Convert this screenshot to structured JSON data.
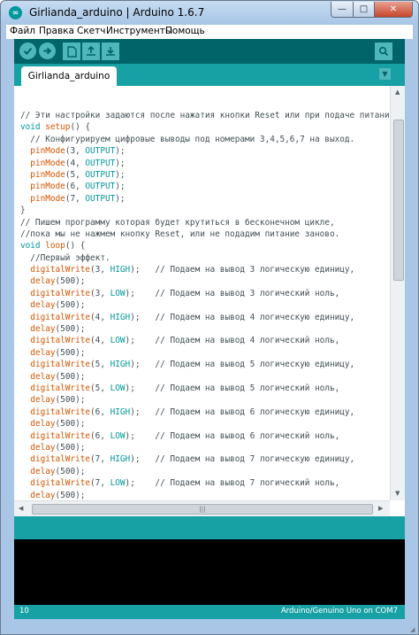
{
  "window": {
    "title": "Girlianda_arduino | Arduino 1.6.7",
    "icon": "arduino-icon"
  },
  "window_controls": {
    "minimize": "—",
    "maximize": "□",
    "close": "✕"
  },
  "menu": [
    "Файл",
    "Правка",
    "Скетч",
    "Инструменты",
    "Помощь"
  ],
  "toolbar": {
    "buttons": [
      "verify-icon",
      "upload-icon",
      "new-icon",
      "open-icon",
      "save-icon"
    ],
    "right_button": "serial-monitor-icon"
  },
  "tab": {
    "label": "Girlianda_arduino"
  },
  "colors": {
    "toolbar": "#006468",
    "teal": "#17a1a5",
    "function": "#d35400",
    "constant": "#00979c"
  },
  "code": [
    "// Эти настройки задаются после нажатия кнопки Reset или при подаче питания.",
    "void setup() {",
    "  // Конфигурируем цифровые выводы под номерами 3,4,5,6,7 на выход.",
    "  pinMode(3, OUTPUT);",
    "  pinMode(4, OUTPUT);",
    "  pinMode(5, OUTPUT);",
    "  pinMode(6, OUTPUT);",
    "  pinMode(7, OUTPUT);",
    "}",
    "// Пишем программу которая будет крутиться в бесконечном цикле,",
    "//пока мы не нажмем кнопку Reset, или не подадим питание заново.",
    "void loop() {",
    "  //Первый эффект.",
    "  digitalWrite(3, HIGH);   // Подаем на вывод 3 логическую единицу,",
    "  delay(500);",
    "  digitalWrite(3, LOW);    // Подаем на вывод 3 логический ноль,",
    "  delay(500);",
    "  digitalWrite(4, HIGH);   // Подаем на вывод 4 логическую единицу,",
    "  delay(500);",
    "  digitalWrite(4, LOW);    // Подаем на вывод 4 логический ноль,",
    "  delay(500);",
    "  digitalWrite(5, HIGH);   // Подаем на вывод 5 логическую единицу,",
    "  delay(500);",
    "  digitalWrite(5, LOW);    // Подаем на вывод 5 логический ноль,",
    "  delay(500);",
    "  digitalWrite(6, HIGH);   // Подаем на вывод 6 логическую единицу,",
    "  delay(500);",
    "  digitalWrite(6, LOW);    // Подаем на вывод 6 логический ноль,",
    "  delay(500);",
    "  digitalWrite(7, HIGH);   // Подаем на вывод 7 логическую единицу,",
    "  delay(500);",
    "  digitalWrite(7, LOW);    // Подаем на вывод 7 логический ноль,",
    "  delay(500);"
  ],
  "status": {
    "line": "10",
    "board": "Arduino/Genuino Uno on COM7"
  }
}
